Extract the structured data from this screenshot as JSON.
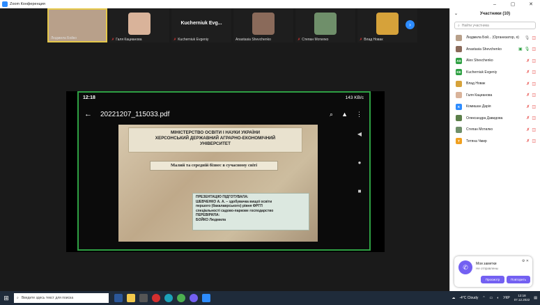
{
  "window": {
    "title": "Zoom Конференция",
    "controls": [
      "–",
      "▢",
      "✕"
    ]
  },
  "gallery": {
    "tiles": [
      {
        "name": "Людмила Бойко",
        "muted": false,
        "active": true,
        "color": "#b8a08a"
      },
      {
        "name": "Галя Кацианова",
        "muted": true,
        "active": false,
        "color": "#d9b39a"
      },
      {
        "name": "Kucherniuk Evgeniy",
        "big": "Kucherniuk Evg...",
        "muted": true,
        "active": false,
        "color": ""
      },
      {
        "name": "Anastasia Shevchenko",
        "muted": false,
        "active": false,
        "color": "#8a6a5a"
      },
      {
        "name": "Степан Мотилко",
        "muted": true,
        "active": false,
        "color": "#6f8f6a"
      },
      {
        "name": "Влад Новак",
        "muted": true,
        "active": false,
        "color": "#d6a23a"
      }
    ]
  },
  "share": {
    "status_time": "12:18",
    "status_net": "143 KB/c",
    "file_name": "20221207_115033.pdf",
    "slide": {
      "header_lines": [
        "МІНІСТЕРСТВО ОСВІТИ І НАУКИ УКРАЇНИ",
        "ХЕРСОНСЬКИЙ ДЕРЖАВНИЙ АГРАРНО-ЕКОНОМІЧНИЙ",
        "УНІВЕРСИТЕТ"
      ],
      "title": "Малий та середній бізнес в сучасному світі",
      "credits": [
        "ПРЕЗЕНТАЦІЮ ПІДГОТУВАЛА:",
        "ШЕВЧЕНКО А. А. – здобувачка вищої освіти",
        "першого (бакалаврського) рівня ФРГП",
        "спеціальності садово-паркове господарство",
        "ПЕРЕВІРИЛА:",
        "БОЙКО Людмила"
      ]
    }
  },
  "participants": {
    "header": "Участники (10)",
    "search_placeholder": "Найти участника",
    "list": [
      {
        "name": "Людмила Бой... (Организатор, я)",
        "initials": "",
        "color": "#b8a08a"
      },
      {
        "name": "Anastasia Shevchenko",
        "initials": "",
        "color": "#8a6a5a"
      },
      {
        "name": "Alex Shevchenko",
        "initials": "AS",
        "color": "#2ea043"
      },
      {
        "name": "Kucherniuk Evgeniy",
        "initials": "KE",
        "color": "#2ea043"
      },
      {
        "name": "Влад Новак",
        "initials": "",
        "color": "#d6a23a"
      },
      {
        "name": "Галя Кацианова",
        "initials": "",
        "color": "#d9b39a"
      },
      {
        "name": "Комишан Дарія",
        "initials": "К",
        "color": "#2d8cff"
      },
      {
        "name": "Олександра Давидова",
        "initials": "",
        "color": "#5b7f4a"
      },
      {
        "name": "Степан Мотилко",
        "initials": "",
        "color": "#6f8f6a"
      },
      {
        "name": "Тетяна Чмир",
        "initials": "Т",
        "color": "#f0a020"
      }
    ]
  },
  "notes": {
    "title": "Мои заметки",
    "subtitle": "Не отправлены",
    "btn_view": "Просмотр",
    "btn_retry": "Повторить"
  },
  "taskbar": {
    "search_placeholder": "Введите здесь текст для поиска",
    "weather": "-4°C  Cloudy",
    "lang": "УКР",
    "time": "12:18",
    "date": "07.12.2022"
  }
}
